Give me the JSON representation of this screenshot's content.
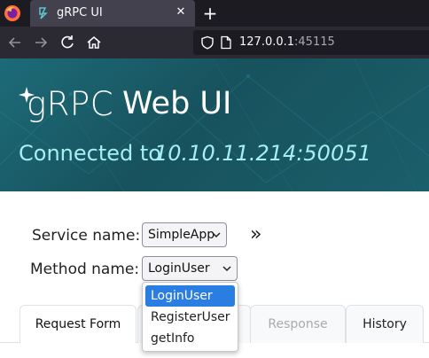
{
  "browser": {
    "tab_title": "gRPC UI",
    "tab_close": "✕",
    "new_tab": "+",
    "url_host": "127.0.0.1",
    "url_port": ":45115"
  },
  "header": {
    "logo": "gRPC",
    "title": "Web UI",
    "connected_label": "Connected to",
    "connected_host": "10.10.11.214:50051"
  },
  "form": {
    "service_label": "Service name:",
    "service_value": "SimpleApp",
    "method_label": "Method name:",
    "method_value": "LoginUser",
    "next_symbol": "»"
  },
  "method_options": [
    "LoginUser",
    "RegisterUser",
    "getInfo"
  ],
  "tabs": {
    "request": "Request Form",
    "response": "Response",
    "history": "History"
  },
  "colors": {
    "header_bg": "#17525d",
    "accent_text": "#a6eff2",
    "option_highlight": "#2a7de1"
  }
}
